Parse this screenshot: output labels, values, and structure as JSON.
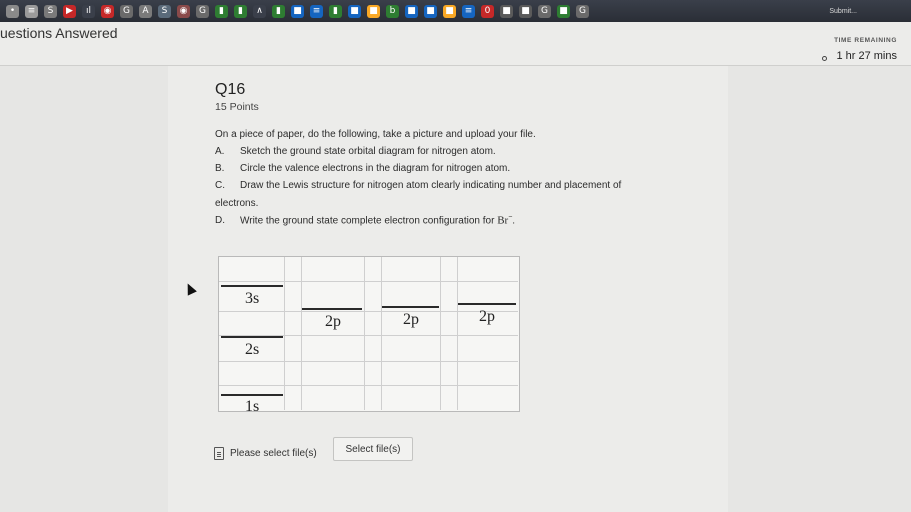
{
  "browser": {
    "tab_icons": [
      {
        "glyph": "•",
        "color": "#8a8a8a"
      },
      {
        "glyph": "≡",
        "color": "#9a9a9a"
      },
      {
        "glyph": "S",
        "color": "#7a7a7a"
      },
      {
        "glyph": "▶",
        "color": "#c62828"
      },
      {
        "glyph": "ıl",
        "color": "#3a3f4a"
      },
      {
        "glyph": "◉",
        "color": "#c62828"
      },
      {
        "glyph": "G",
        "color": "#6a6a6a"
      },
      {
        "glyph": "A",
        "color": "#7a7a7a"
      },
      {
        "glyph": "S",
        "color": "#5a6a7a"
      },
      {
        "glyph": "◉",
        "color": "#8a4a4a"
      },
      {
        "glyph": "G",
        "color": "#6a6a6a"
      },
      {
        "glyph": "▮",
        "color": "#2e7d32"
      },
      {
        "glyph": "▮",
        "color": "#2e7d32"
      },
      {
        "glyph": "∧",
        "color": "#3a3f4a"
      },
      {
        "glyph": "▮",
        "color": "#2e7d32"
      },
      {
        "glyph": "■",
        "color": "#1565c0"
      },
      {
        "glyph": "≡",
        "color": "#1565c0"
      },
      {
        "glyph": "▮",
        "color": "#2e7d32"
      },
      {
        "glyph": "■",
        "color": "#1565c0"
      },
      {
        "glyph": "■",
        "color": "#f9a825"
      },
      {
        "glyph": "b",
        "color": "#2e7d32"
      },
      {
        "glyph": "■",
        "color": "#1565c0"
      },
      {
        "glyph": "■",
        "color": "#1565c0"
      },
      {
        "glyph": "■",
        "color": "#f9a825"
      },
      {
        "glyph": "≡",
        "color": "#1565c0"
      },
      {
        "glyph": "0",
        "color": "#c62828"
      },
      {
        "glyph": "■",
        "color": "#5a5a5a"
      },
      {
        "glyph": "■",
        "color": "#5a5a5a"
      },
      {
        "glyph": "G",
        "color": "#6a6a6a"
      },
      {
        "glyph": "■",
        "color": "#2e7d32"
      },
      {
        "glyph": "G",
        "color": "#6a6a6a"
      }
    ],
    "submit_label": "Submit..."
  },
  "header": {
    "title": "uestions Answered",
    "time_label": "TIME REMAINING",
    "time_value": "1 hr 27 mins"
  },
  "question": {
    "number": "Q16",
    "points": "15 Points",
    "intro": "On a piece of paper, do the following, take a picture and upload your file.",
    "items": {
      "a_letter": "A.",
      "a_text": "Sketch the ground state orbital diagram for nitrogen atom.",
      "b_letter": "B.",
      "b_text": "Circle the valence electrons in the diagram for nitrogen atom.",
      "c_letter": "C.",
      "c_text": "Draw the Lewis structure for nitrogen atom clearly indicating number and placement of",
      "c_cont": "electrons.",
      "d_letter": "D.",
      "d_text": "Write the ground state complete electron configuration for",
      "d_formula": "Br",
      "d_charge": "−",
      "d_end": "."
    }
  },
  "diagram": {
    "labels": {
      "s3": "3s",
      "p_a": "2p",
      "p_b": "2p",
      "p_c": "2p",
      "s2": "2s",
      "s1": "1s"
    }
  },
  "upload": {
    "status": "Please select file(s)",
    "button_label": "Select file(s)"
  }
}
